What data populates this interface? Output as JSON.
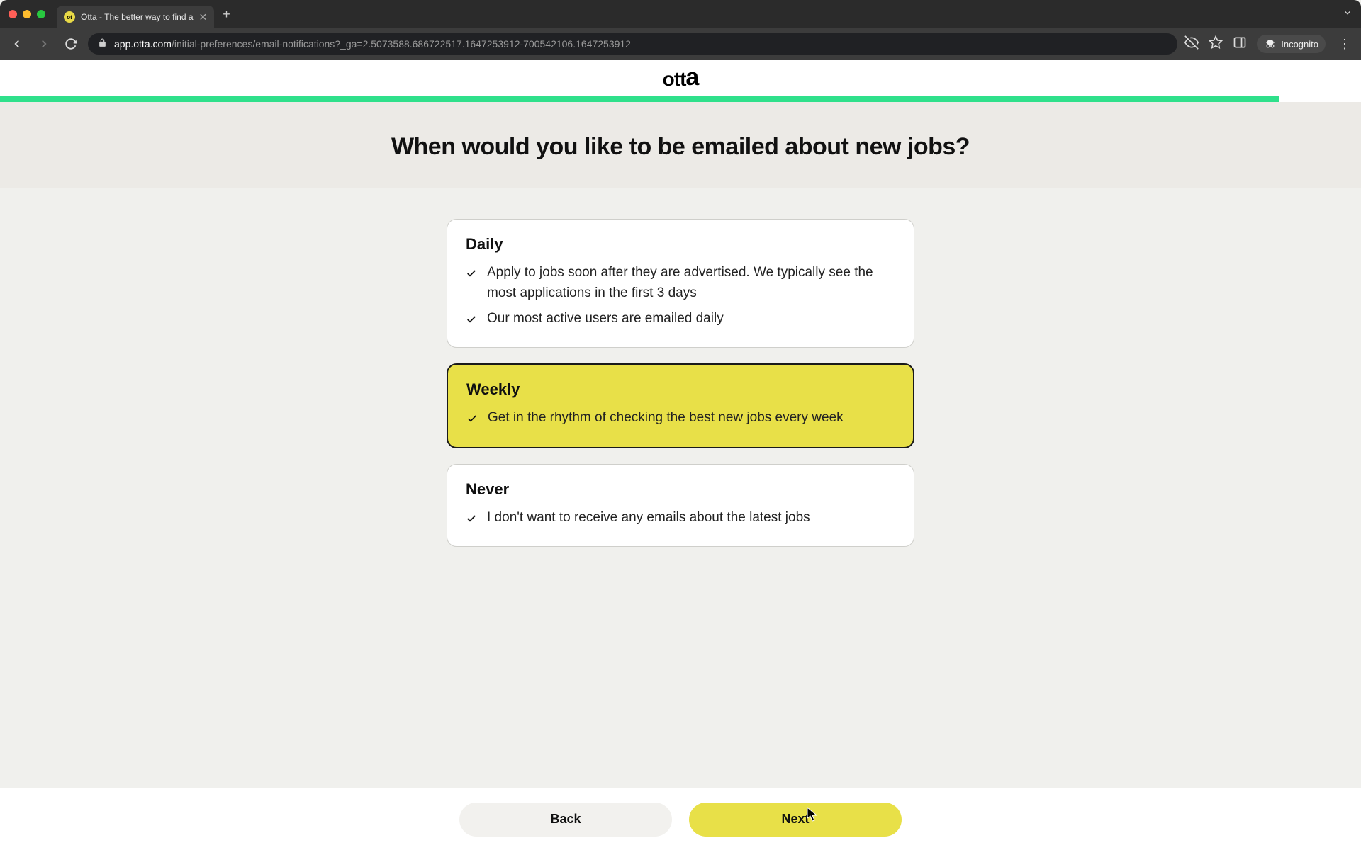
{
  "browser": {
    "tab_title": "Otta - The better way to find a",
    "url_domain": "app.otta.com",
    "url_path": "/initial-preferences/email-notifications?_ga=2.5073588.686722517.1647253912-700542106.1647253912",
    "incognito_label": "Incognito"
  },
  "page": {
    "logo": "otta",
    "progress_percent": 94,
    "question": "When would you like to be emailed about new jobs?",
    "options": [
      {
        "title": "Daily",
        "selected": false,
        "bullets": [
          "Apply to jobs soon after they are advertised. We typically see the most applications in the first 3 days",
          "Our most active users are emailed daily"
        ]
      },
      {
        "title": "Weekly",
        "selected": true,
        "bullets": [
          "Get in the rhythm of checking the best new jobs every week"
        ]
      },
      {
        "title": "Never",
        "selected": false,
        "bullets": [
          "I don't want to receive any emails about the latest jobs"
        ]
      }
    ],
    "footer": {
      "back_label": "Back",
      "next_label": "Next"
    }
  }
}
